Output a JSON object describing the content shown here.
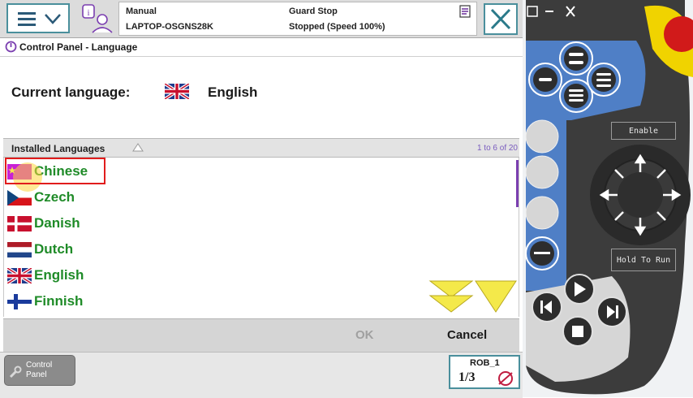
{
  "header": {
    "mode": "Manual",
    "controller": "LAPTOP-OSGNS28K",
    "state": "Guard Stop",
    "speed_status": "Stopped (Speed 100%)",
    "icons": [
      "menu-icon",
      "chevron-down-icon",
      "user-icon",
      "info-icon",
      "status-icon",
      "close-icon"
    ]
  },
  "page": {
    "title": "Control Panel - Language",
    "current_language_label": "Current language:",
    "current_language_value": "English"
  },
  "list": {
    "header": "Installed Languages",
    "count": "1 to 6 of 20",
    "items": [
      {
        "label": "Chinese",
        "flag": "china-flag"
      },
      {
        "label": "Czech",
        "flag": "czech-flag"
      },
      {
        "label": "Danish",
        "flag": "denmark-flag"
      },
      {
        "label": "Dutch",
        "flag": "netherlands-flag"
      },
      {
        "label": "English",
        "flag": "uk-flag"
      },
      {
        "label": "Finnish",
        "flag": "finland-flag"
      }
    ],
    "selected": "Chinese"
  },
  "buttons": {
    "ok": "OK",
    "cancel": "Cancel"
  },
  "taskbar": {
    "control_panel_line1": "Control",
    "control_panel_line2": "Panel",
    "robot": "ROB_1",
    "fraction": "1/3"
  },
  "hardware": {
    "enable_label": "Enable",
    "hold_label": "Hold To Run"
  },
  "colors": {
    "accent_teal": "#4a8f9c",
    "language_text": "#1f8b28",
    "highlight_red": "#e11c1c",
    "scroll_yellow": "#f4e94a",
    "count_purple": "#7a5cbf"
  }
}
